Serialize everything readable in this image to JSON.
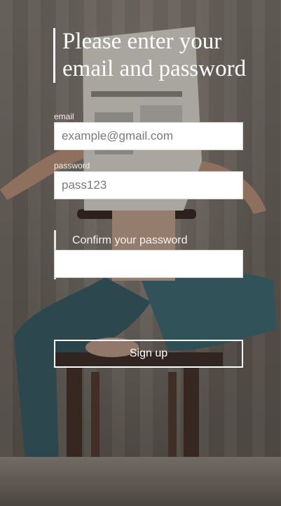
{
  "form": {
    "title": "Please enter your email and password",
    "email": {
      "label": "email",
      "placeholder": "example@gmail.com",
      "value": ""
    },
    "password": {
      "label": "password",
      "placeholder": "pass123",
      "value": ""
    },
    "confirm_password": {
      "label": "Confirm your password",
      "value": ""
    },
    "signup_label": "Sign up"
  },
  "theme": {
    "text_color": "#ffffff",
    "input_background": "#ffffff",
    "button_border": "#ffffff"
  }
}
